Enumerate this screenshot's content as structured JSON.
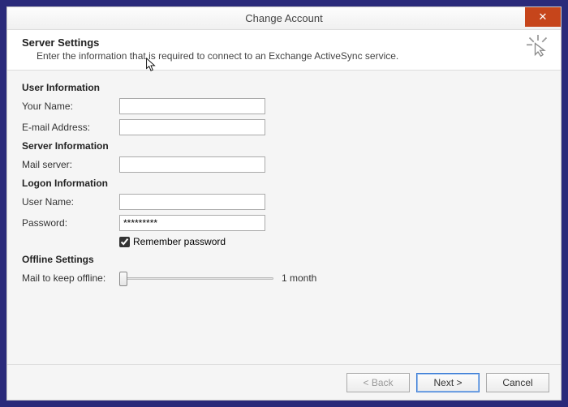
{
  "window": {
    "title": "Change Account"
  },
  "header": {
    "title": "Server Settings",
    "subtitle": "Enter the information that is required to connect to an Exchange ActiveSync service."
  },
  "sections": {
    "user_info": {
      "title": "User Information",
      "your_name_label": "Your Name:",
      "your_name_value": "",
      "email_label": "E-mail Address:",
      "email_value": ""
    },
    "server_info": {
      "title": "Server Information",
      "mail_server_label": "Mail server:",
      "mail_server_value": ""
    },
    "logon_info": {
      "title": "Logon Information",
      "username_label": "User Name:",
      "username_value": "",
      "password_label": "Password:",
      "password_value": "*********",
      "remember_label": "Remember password",
      "remember_checked": true
    },
    "offline": {
      "title": "Offline Settings",
      "slider_label": "Mail to keep offline:",
      "slider_value_label": "1 month"
    }
  },
  "footer": {
    "back": "< Back",
    "next": "Next >",
    "cancel": "Cancel"
  }
}
